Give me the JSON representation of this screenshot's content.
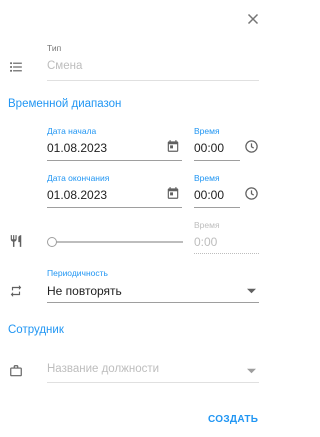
{
  "dialog": {
    "type_label": "Тип",
    "type_placeholder": "Смена",
    "time_section_title": "Временной диапазон",
    "start_date_label": "Дата начала",
    "start_date_value": "01.08.2023",
    "start_time_label": "Время",
    "start_time_value": "00:00",
    "end_date_label": "Дата окончания",
    "end_date_value": "01.08.2023",
    "end_time_label": "Время",
    "end_time_value": "00:00",
    "break_time_label": "Время",
    "break_time_value": "0:00",
    "break_slider_value": 0,
    "repeat_label": "Периодичность",
    "repeat_value": "Не повторять",
    "employee_section_title": "Сотрудник",
    "position_placeholder": "Название должности",
    "create_button": "СОЗДАТЬ"
  },
  "colors": {
    "accent": "#2196f3",
    "icon": "#616161",
    "disabled": "#bdbdbd"
  },
  "icons": [
    "close-icon",
    "list-icon",
    "calendar-icon",
    "clock-icon",
    "restaurant-icon",
    "repeat-icon",
    "briefcase-icon",
    "dropdown-arrow-icon"
  ]
}
